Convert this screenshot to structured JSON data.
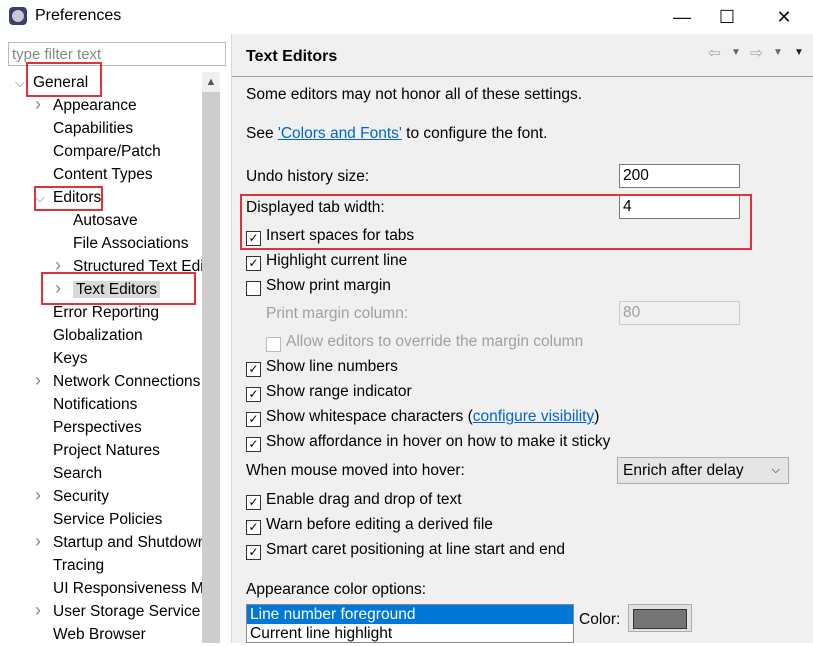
{
  "window": {
    "title": "Preferences",
    "icon": "eclipse-icon",
    "minimize": "—",
    "maximize": "☐",
    "close": "✕"
  },
  "sidebar": {
    "filter_placeholder": "type filter text",
    "items": [
      {
        "label": "General",
        "level": 0,
        "expander": "expanded"
      },
      {
        "label": "Appearance",
        "level": 1,
        "expander": "collapsed"
      },
      {
        "label": "Capabilities",
        "level": 1,
        "expander": "none"
      },
      {
        "label": "Compare/Patch",
        "level": 1,
        "expander": "none"
      },
      {
        "label": "Content Types",
        "level": 1,
        "expander": "none"
      },
      {
        "label": "Editors",
        "level": 1,
        "expander": "expanded"
      },
      {
        "label": "Autosave",
        "level": 2,
        "expander": "none"
      },
      {
        "label": "File Associations",
        "level": 2,
        "expander": "none"
      },
      {
        "label": "Structured Text Editors",
        "level": 2,
        "expander": "collapsed"
      },
      {
        "label": "Text Editors",
        "level": 2,
        "expander": "collapsed",
        "selected": true
      },
      {
        "label": "Error Reporting",
        "level": 1,
        "expander": "none"
      },
      {
        "label": "Globalization",
        "level": 1,
        "expander": "none"
      },
      {
        "label": "Keys",
        "level": 1,
        "expander": "none"
      },
      {
        "label": "Network Connections",
        "level": 1,
        "expander": "collapsed"
      },
      {
        "label": "Notifications",
        "level": 1,
        "expander": "none"
      },
      {
        "label": "Perspectives",
        "level": 1,
        "expander": "none"
      },
      {
        "label": "Project Natures",
        "level": 1,
        "expander": "none"
      },
      {
        "label": "Search",
        "level": 1,
        "expander": "none"
      },
      {
        "label": "Security",
        "level": 1,
        "expander": "collapsed"
      },
      {
        "label": "Service Policies",
        "level": 1,
        "expander": "none"
      },
      {
        "label": "Startup and Shutdown",
        "level": 1,
        "expander": "collapsed"
      },
      {
        "label": "Tracing",
        "level": 1,
        "expander": "none"
      },
      {
        "label": "UI Responsiveness Monitoring",
        "level": 1,
        "expander": "none"
      },
      {
        "label": "User Storage Service",
        "level": 1,
        "expander": "collapsed"
      },
      {
        "label": "Web Browser",
        "level": 1,
        "expander": "none"
      }
    ]
  },
  "main": {
    "title": "Text Editors",
    "note": "Some editors may not honor all of these settings.",
    "see_prefix": "See ",
    "see_link": "'Colors and Fonts'",
    "see_suffix": " to configure the font.",
    "undo_label": "Undo history size:",
    "undo_value": "200",
    "tab_width_label": "Displayed tab width:",
    "tab_width_value": "4",
    "print_margin_col_label": "Print margin column:",
    "print_margin_col_value": "80",
    "checkboxes": [
      {
        "label": "Insert spaces for tabs",
        "checked": true
      },
      {
        "label": "Highlight current line",
        "checked": true
      },
      {
        "label": "Show print margin",
        "checked": false
      },
      {
        "label": "Allow editors to override the margin column",
        "checked": false,
        "disabled": true
      },
      {
        "label": "Show line numbers",
        "checked": true
      },
      {
        "label": "Show range indicator",
        "checked": true
      },
      {
        "label": "Show whitespace characters (",
        "checked": true,
        "link": "configure visibility",
        "suffix": ")"
      },
      {
        "label": "Show affordance in hover on how to make it sticky",
        "checked": true
      },
      {
        "label": "Enable drag and drop of text",
        "checked": true
      },
      {
        "label": "Warn before editing a derived file",
        "checked": true
      },
      {
        "label": "Smart caret positioning at line start and end",
        "checked": true
      }
    ],
    "hover_label": "When mouse moved into hover:",
    "hover_value": "Enrich after delay",
    "appearance_label": "Appearance color options:",
    "color_options": [
      "Line number foreground",
      "Current line highlight"
    ],
    "color_label": "Color:",
    "color_value": "#747474",
    "selection_color": "#0078d7",
    "highlight_color": "#e0323c"
  }
}
